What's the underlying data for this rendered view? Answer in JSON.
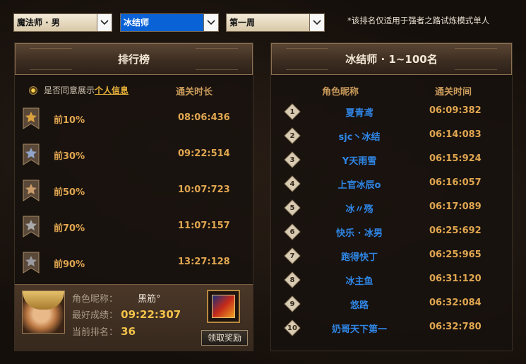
{
  "filters": {
    "class_select": "魔法师 · 男",
    "subclass_select": "冰结师",
    "week_select": "第一周",
    "note": "*该排名仅适用于强者之路试炼模式单人"
  },
  "left_panel": {
    "title": "排行榜",
    "agree_text": "是否同意展示",
    "agree_link": "个人信息",
    "col_time": "通关时长",
    "tiers": [
      {
        "label": "前10%",
        "time": "08:06:436",
        "color": "#d9a03e"
      },
      {
        "label": "前30%",
        "time": "09:22:514",
        "color": "#8fa4c8"
      },
      {
        "label": "前50%",
        "time": "10:07:723",
        "color": "#c99b6a"
      },
      {
        "label": "前70%",
        "time": "11:07:157",
        "color": "#a9a9a9"
      },
      {
        "label": "前90%",
        "time": "13:27:128",
        "color": "#9a9aa0"
      }
    ],
    "profile": {
      "nick_label": "角色昵称：",
      "nick": "黑筋°",
      "best_label": "最好成绩：",
      "best": "09:22:307",
      "rank_label": "当前排名：",
      "rank": "36",
      "reward_button": "领取奖励"
    }
  },
  "right_panel": {
    "title": "冰结师 · 1~100名",
    "col_name": "角色昵称",
    "col_time": "通关时间",
    "rows": [
      {
        "rank": "1",
        "name": "夏青鸢",
        "time": "06:09:382"
      },
      {
        "rank": "2",
        "name": "sjc丶冰结",
        "time": "06:14:083"
      },
      {
        "rank": "3",
        "name": "Y天雨雪",
        "time": "06:15:924"
      },
      {
        "rank": "4",
        "name": "上官冰辰o",
        "time": "06:16:057"
      },
      {
        "rank": "5",
        "name": "冰〃殇",
        "time": "06:17:089"
      },
      {
        "rank": "6",
        "name": "快乐 · 冰男",
        "time": "06:25:692"
      },
      {
        "rank": "7",
        "name": "跑得快丁",
        "time": "06:25:965"
      },
      {
        "rank": "8",
        "name": "冰主鱼",
        "time": "06:31:120"
      },
      {
        "rank": "9",
        "name": "悠路",
        "time": "06:32:084"
      },
      {
        "rank": "10",
        "name": "奶哥天下第一",
        "time": "06:32:780"
      }
    ]
  }
}
